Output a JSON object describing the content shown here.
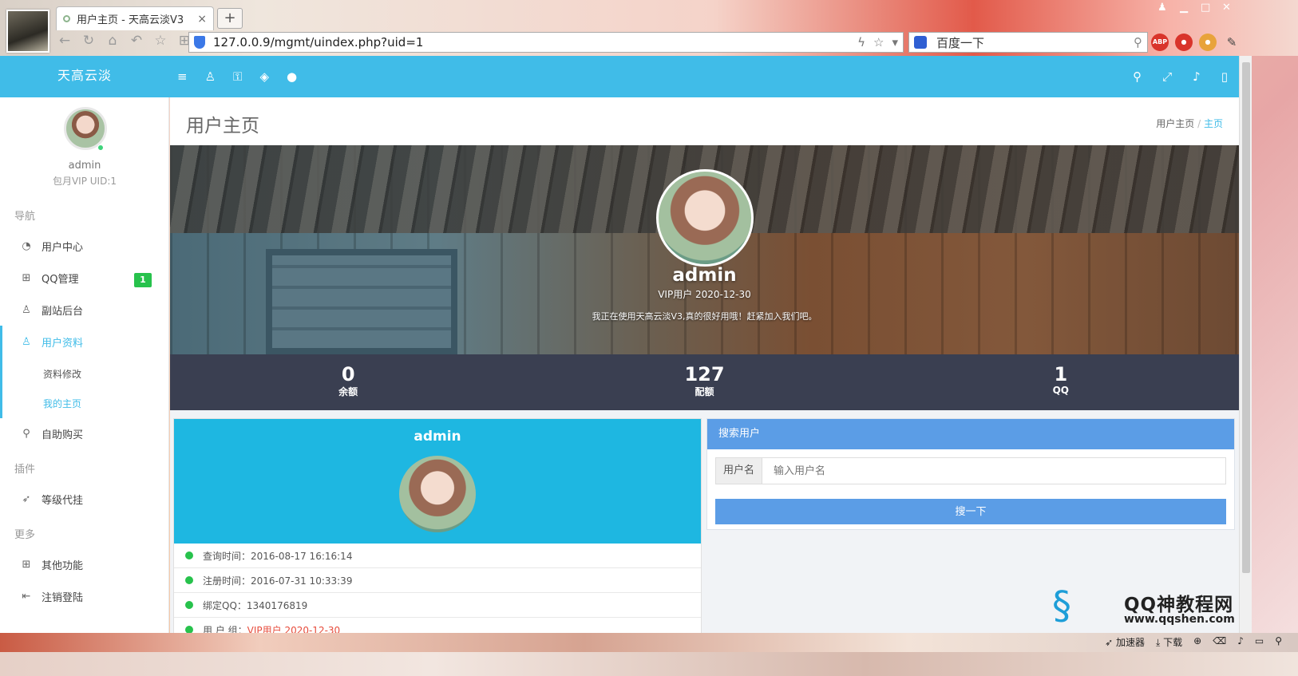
{
  "browser": {
    "tab_title": "用户主页 - 天高云淡V3",
    "new_tab": "+",
    "close": "×",
    "url": "127.0.0.9/mgmt/uindex.php?uid=1",
    "search_text": "百度一下",
    "ext_abp": "ABP"
  },
  "header": {
    "brand": "天高云淡"
  },
  "sidebar": {
    "username": "admin",
    "subtitle": "包月VIP UID:1",
    "sections": {
      "nav": "导航",
      "plugins": "插件",
      "more": "更多"
    },
    "items": {
      "user_center": "用户中心",
      "qq_manage": "QQ管理",
      "qq_badge": "1",
      "substation": "副站后台",
      "user_profile": "用户资料",
      "edit_profile": "资料修改",
      "my_home": "我的主页",
      "self_buy": "自助购买",
      "level_agent": "等级代挂",
      "other": "其他功能",
      "logout": "注销登陆"
    }
  },
  "page": {
    "title": "用户主页",
    "breadcrumb_parent": "用户主页",
    "breadcrumb_sep": "/",
    "breadcrumb_current": "主页"
  },
  "hero": {
    "name": "admin",
    "vip": "VIP用户 2020-12-30",
    "motto": "我正在使用天高云淡V3,真的很好用哦！赶紧加入我们吧。"
  },
  "stats": [
    {
      "value": "0",
      "label": "余额"
    },
    {
      "value": "127",
      "label": "配额"
    },
    {
      "value": "1",
      "label": "QQ"
    }
  ],
  "profile": {
    "name": "admin",
    "rows": {
      "query_time": "查询时间：2016-08-17 16:16:14",
      "reg_time": "注册时间：2016-07-31 10:33:39",
      "bind_qq": "绑定QQ：1340176819",
      "group_label": "用 户 组：",
      "group_value": "VIP用户 2020-12-30"
    }
  },
  "search": {
    "title": "搜索用户",
    "addon": "用户名",
    "placeholder": "输入用户名",
    "button": "搜一下"
  },
  "statusbar": {
    "accelerator": "加速器",
    "download": "下载"
  },
  "watermark": {
    "title": "QQ神教程网",
    "url": "www.qqshen.com"
  }
}
